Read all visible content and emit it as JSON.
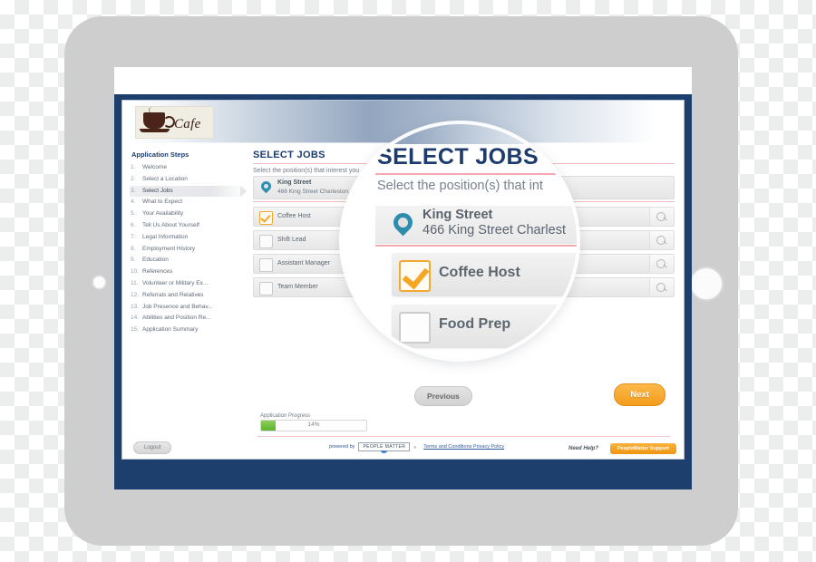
{
  "device": {
    "type": "tablet",
    "frame_color": "#cecece",
    "home_button": "home-button",
    "camera": "front-camera"
  },
  "app": {
    "brand_logo_text": "Cafe",
    "border_color": "#1c3f6e",
    "sidebar": {
      "title": "Application Steps",
      "active_index": 2,
      "items": [
        {
          "num": "1.",
          "label": "Welcome"
        },
        {
          "num": "2.",
          "label": "Select a Location"
        },
        {
          "num": "3.",
          "label": "Select Jobs"
        },
        {
          "num": "4.",
          "label": "What to Expect"
        },
        {
          "num": "5.",
          "label": "Your Availability"
        },
        {
          "num": "6.",
          "label": "Tell Us About Yourself"
        },
        {
          "num": "7.",
          "label": "Legal Information"
        },
        {
          "num": "8.",
          "label": "Employment History"
        },
        {
          "num": "9.",
          "label": "Education"
        },
        {
          "num": "10.",
          "label": "References"
        },
        {
          "num": "11.",
          "label": "Volunteer or Military Ex..."
        },
        {
          "num": "12.",
          "label": "Referrals and Relatives"
        },
        {
          "num": "13.",
          "label": "Job Presence and Behav..."
        },
        {
          "num": "14.",
          "label": "Abilities and Position Re..."
        },
        {
          "num": "15.",
          "label": "Application Summary"
        }
      ]
    },
    "content": {
      "title": "SELECT JOBS",
      "subtitle": "Select the position(s) that interest you",
      "location": {
        "name": "King Street",
        "address": "466 King Street Charleston, SC"
      },
      "jobs": [
        {
          "label": "Coffee Host",
          "checked": true
        },
        {
          "label": "Shift Lead",
          "checked": false
        },
        {
          "label": "Assistant Manager",
          "checked": false
        },
        {
          "label": "Team Member",
          "checked": false
        }
      ],
      "jobs_magnified": [
        {
          "label": "Coffee Host",
          "checked": true
        },
        {
          "label": "Food Prep",
          "checked": false
        }
      ]
    },
    "actions": {
      "previous_label": "Previous",
      "next_label": "Next",
      "logout_label": "Logout",
      "support_label": "PeopleMatter Support"
    },
    "progress": {
      "label": "Application Progress",
      "percent_text": "14%",
      "percent_value": 14,
      "fill_color": "#5eb230"
    },
    "footer": {
      "powered_by": "powered by",
      "vendor_badge": "PEOPLE MATTER",
      "registered_mark": "®",
      "terms_link": "Terms and Conditions  Privacy Policy",
      "need_help": "Need Help?"
    }
  },
  "magnifier": {
    "title": "SELECT JOBS",
    "subtitle": "Select the position(s) that int",
    "location_name": "King Street",
    "location_address": "466 King Street Charlest",
    "accent_rule_color": "#f3a9b0",
    "checkbox_accent": "#f6a623"
  }
}
